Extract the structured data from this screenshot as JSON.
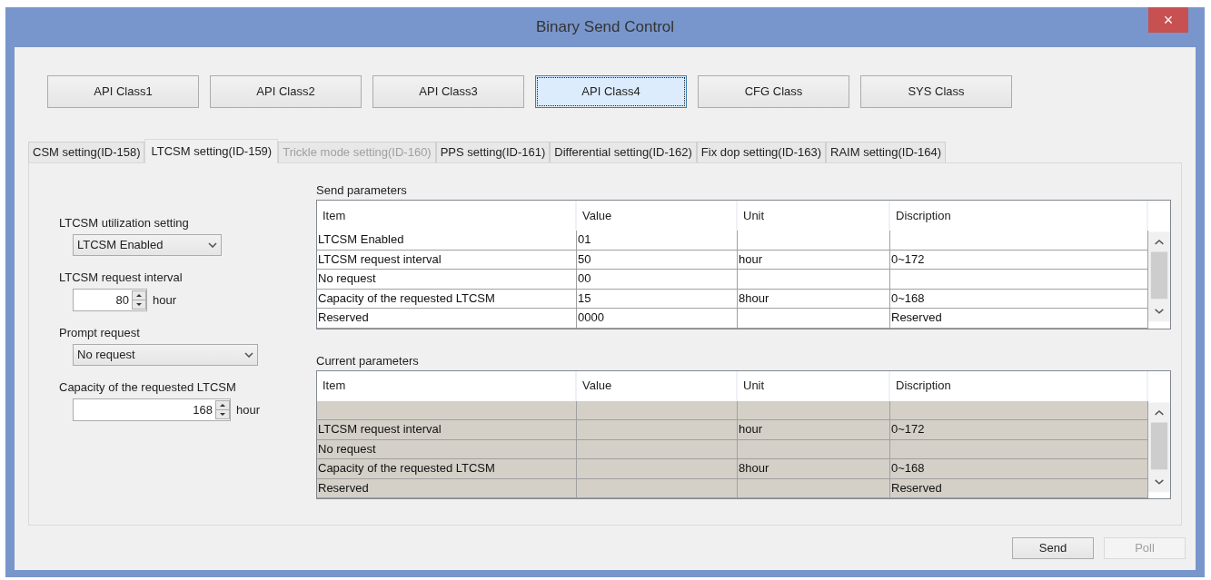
{
  "window": {
    "title": "Binary Send Control",
    "close": "×"
  },
  "class_buttons": [
    {
      "label": "API Class1",
      "selected": false
    },
    {
      "label": "API Class2",
      "selected": false
    },
    {
      "label": "API Class3",
      "selected": false
    },
    {
      "label": "API Class4",
      "selected": true
    },
    {
      "label": "CFG Class",
      "selected": false
    },
    {
      "label": "SYS Class",
      "selected": false
    }
  ],
  "tabs": [
    {
      "label": "CSM setting(ID-158)",
      "selected": false,
      "disabled": false
    },
    {
      "label": "LTCSM setting(ID-159)",
      "selected": true,
      "disabled": false
    },
    {
      "label": "Trickle mode setting(ID-160)",
      "selected": false,
      "disabled": true
    },
    {
      "label": "PPS setting(ID-161)",
      "selected": false,
      "disabled": false
    },
    {
      "label": "Differential setting(ID-162)",
      "selected": false,
      "disabled": false
    },
    {
      "label": "Fix dop setting(ID-163)",
      "selected": false,
      "disabled": false
    },
    {
      "label": "RAIM setting(ID-164)",
      "selected": false,
      "disabled": false
    }
  ],
  "settings": [
    {
      "kind": "combo",
      "label": "LTCSM utilization setting",
      "value": "LTCSM Enabled"
    },
    {
      "kind": "spin",
      "label": "LTCSM request interval",
      "value": "80",
      "unit": "hour"
    },
    {
      "kind": "combo",
      "label": "Prompt request",
      "value": "No request"
    },
    {
      "kind": "spin",
      "label": "Capacity of the requested LTCSM",
      "value": "168",
      "unit": "hour"
    }
  ],
  "tables": [
    {
      "title": "Send parameters",
      "readonly": false,
      "columns": [
        "Item",
        "Value",
        "Unit",
        "Discription"
      ],
      "rows": [
        [
          "LTCSM Enabled",
          "01",
          null,
          null
        ],
        [
          "LTCSM request interval",
          "50",
          "hour",
          "0~172"
        ],
        [
          "No request",
          "00",
          null,
          null
        ],
        [
          "Capacity of the requested LTCSM",
          "15",
          "8hour",
          "0~168"
        ],
        [
          "Reserved",
          "0000",
          null,
          "Reserved"
        ]
      ]
    },
    {
      "title": "Current parameters",
      "readonly": true,
      "columns": [
        "Item",
        "Value",
        "Unit",
        "Discription"
      ],
      "rows": [
        [
          null,
          null,
          null,
          null
        ],
        [
          "LTCSM request interval",
          null,
          "hour",
          "0~172"
        ],
        [
          "No request",
          null,
          null,
          null
        ],
        [
          "Capacity of the requested LTCSM",
          null,
          "8hour",
          "0~168"
        ],
        [
          "Reserved",
          null,
          null,
          "Reserved"
        ]
      ]
    }
  ],
  "buttons": [
    {
      "label": "Send",
      "disabled": false
    },
    {
      "label": "Poll",
      "disabled": true
    }
  ]
}
